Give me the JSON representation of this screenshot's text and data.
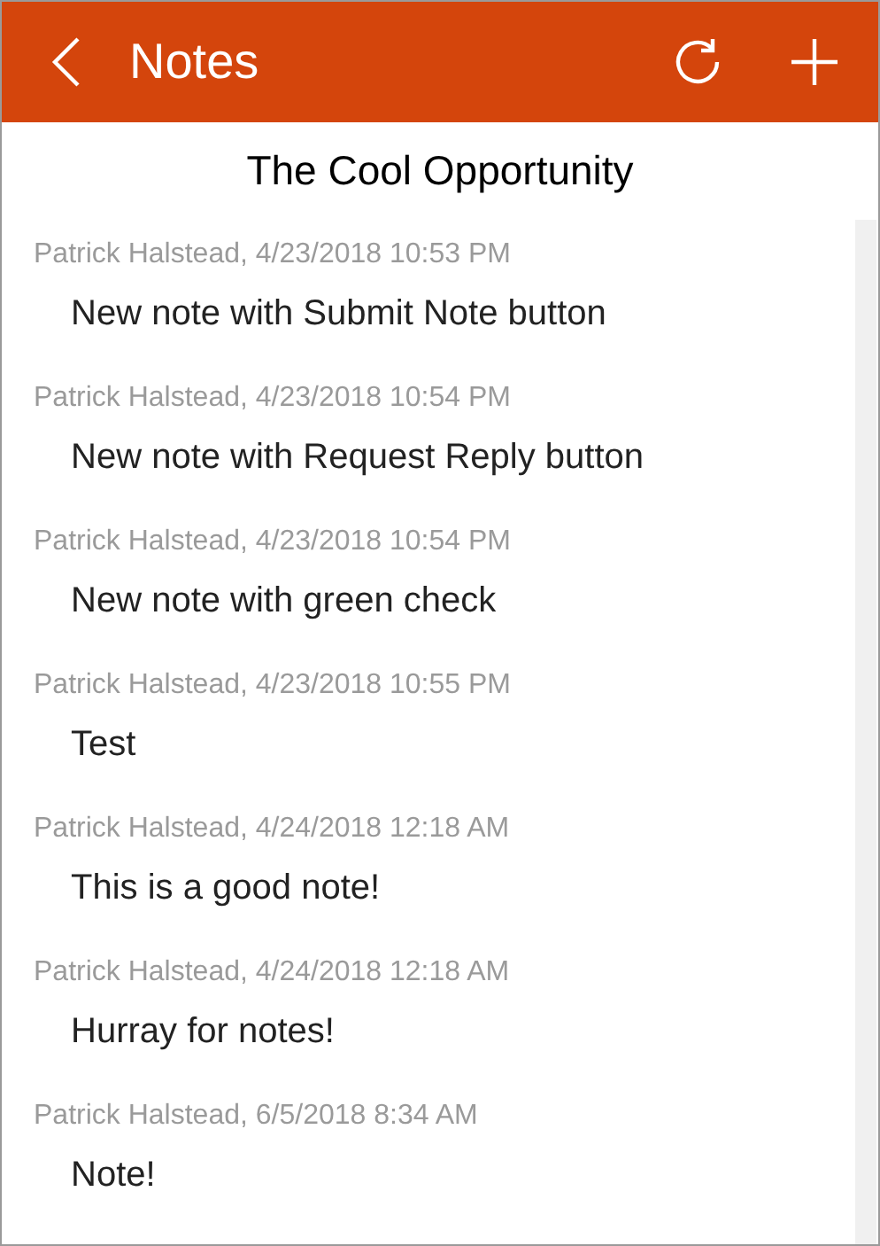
{
  "header": {
    "title": "Notes"
  },
  "record": {
    "title": "The Cool Opportunity"
  },
  "notes": [
    {
      "meta": "Patrick Halstead, 4/23/2018 10:53 PM",
      "text": "New note with Submit Note button"
    },
    {
      "meta": "Patrick Halstead, 4/23/2018 10:54 PM",
      "text": "New note with Request Reply button"
    },
    {
      "meta": "Patrick Halstead, 4/23/2018 10:54 PM",
      "text": "New note with green check"
    },
    {
      "meta": "Patrick Halstead, 4/23/2018 10:55 PM",
      "text": "Test"
    },
    {
      "meta": "Patrick Halstead, 4/24/2018 12:18 AM",
      "text": "This is a good note!"
    },
    {
      "meta": "Patrick Halstead, 4/24/2018 12:18 AM",
      "text": "Hurray for notes!"
    },
    {
      "meta": "Patrick Halstead, 6/5/2018 8:34 AM",
      "text": "Note!"
    }
  ]
}
